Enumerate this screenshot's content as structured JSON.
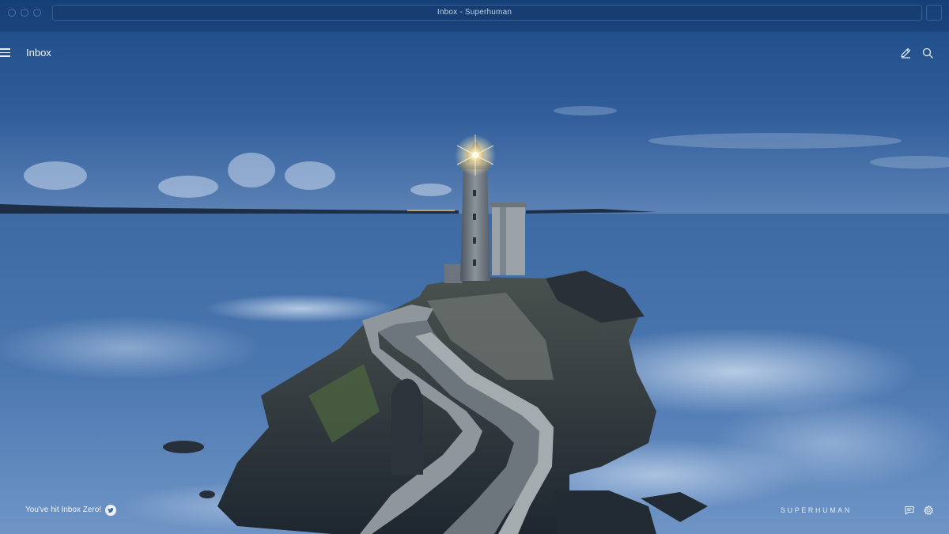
{
  "window": {
    "title": "Inbox - Superhuman"
  },
  "header": {
    "title": "Inbox",
    "menu_icon": "hamburger-menu-icon",
    "compose_icon": "pencil-icon",
    "search_icon": "search-icon"
  },
  "footer": {
    "status": "You've hit Inbox Zero!",
    "share_icon": "twitter-icon",
    "brand": "SUPERHUMAN",
    "feedback_icon": "chat-bubble-icon",
    "settings_icon": "gear-icon"
  },
  "background": {
    "subject": "lighthouse at dusk",
    "sky_color": "#3f6aa5",
    "sea_color": "#3d67a0"
  }
}
